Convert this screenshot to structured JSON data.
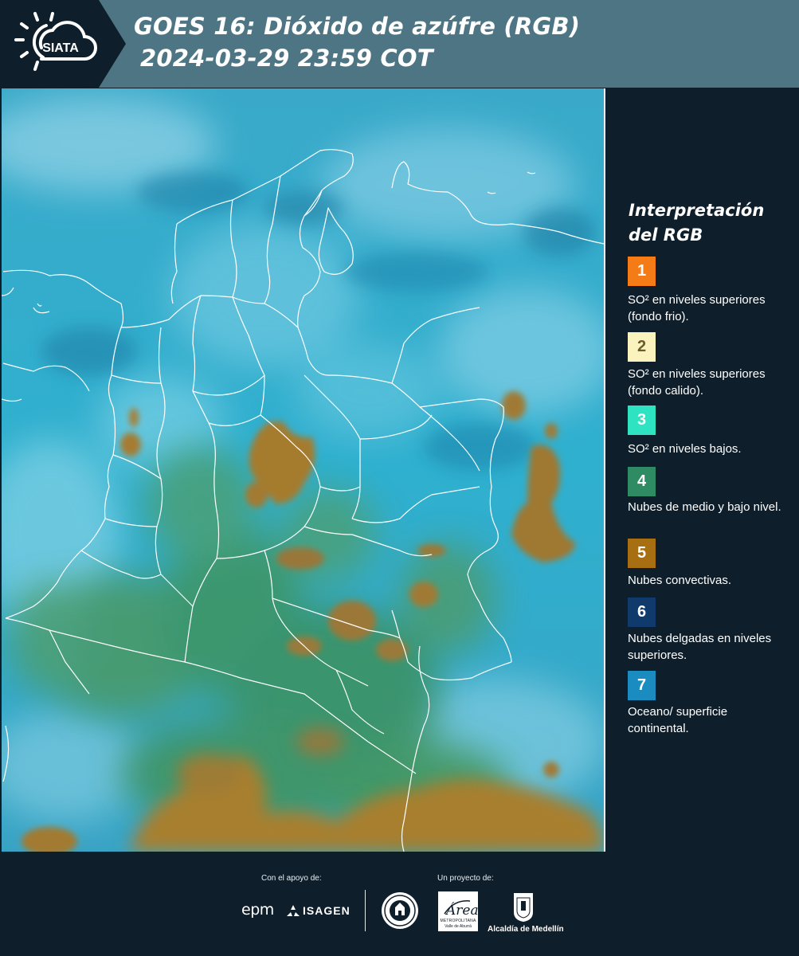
{
  "header": {
    "logo_text": "SIATA",
    "title_line1": "GOES 16: Dióxido de azúfre (RGB)",
    "title_line2": "2024-03-29 23:59 COT"
  },
  "legend": {
    "title_line1": "Interpretación",
    "title_line2": "del RGB",
    "items": [
      {
        "num": "1",
        "color": "#f47b16",
        "label": "SO² en niveles superiores (fondo frio)."
      },
      {
        "num": "2",
        "color": "#fbf3be",
        "label": "SO² en niveles superiores (fondo calido)."
      },
      {
        "num": "3",
        "color": "#2ee3c2",
        "label": "SO² en niveles bajos."
      },
      {
        "num": "4",
        "color": "#2e8b63",
        "label": "Nubes de medio y bajo nivel."
      },
      {
        "num": "5",
        "color": "#a86e12",
        "label": "Nubes convectivas."
      },
      {
        "num": "6",
        "color": "#0f3a6b",
        "label": "Nubes delgadas en niveles superiores."
      },
      {
        "num": "7",
        "color": "#1a8cc0",
        "label": "Oceano/ superficie continental."
      }
    ]
  },
  "footer": {
    "support_label": "Con el apoyo de:",
    "project_label": "Un proyecto de:",
    "epm": "epm",
    "isagen": "ISAGEN",
    "area_label": "Área",
    "area_sub1": "METROPOLITANA",
    "area_sub2": "Valle de Aburrá",
    "alcaldia": "Alcaldía de Medellín"
  }
}
